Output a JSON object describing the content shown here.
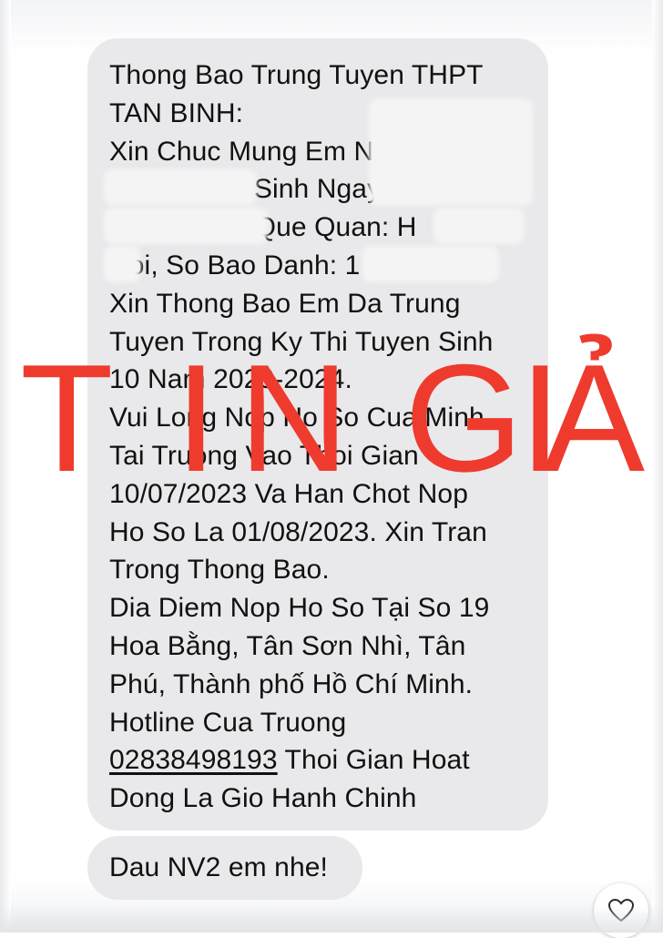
{
  "messages": [
    {
      "lines": [
        "Thong Bao Trung Tuyen THPT",
        "TAN BINH:",
        "Xin Chuc Mung Em Ng",
        ", Sinh Ngay",
        "2 /10/2008, Que Quan: H",
        "Noi, So Bao Danh: 1",
        "Xin Thong Bao Em Da Trung",
        "Tuyen Trong Ky Thi Tuyen Sinh",
        "10 Nam 2023-2024.",
        "Vui Long Nop Ho So Cua Minh",
        "Tai Truong Vao Thoi Gian",
        "10/07/2023 Va Han Chot Nop",
        "Ho So La 01/08/2023. Xin Tran",
        "Trong Thong Bao.",
        "Dia Diem Nop Ho So Tại So 19",
        "Hoa Bằng, Tân Sơn Nhì, Tân",
        "Phú, Thành phố Hồ Chí Minh.",
        "Hotline Cua Truong"
      ],
      "phone": "02838498193",
      "phone_tail": " Thoi Gian Hoat",
      "last_line": "Dong La Gio Hanh Chinh"
    },
    {
      "text": "Dau NV2 em nhe!"
    }
  ],
  "overlay": {
    "letters": [
      "T",
      "I",
      "N",
      "G",
      "I",
      "Ả"
    ],
    "text": "TIN GIẢ",
    "color": "#ee3b2e"
  },
  "reaction": {
    "icon": "heart-icon"
  },
  "colors": {
    "bubble": "#e9e9eb",
    "background": "#ffffff",
    "text": "#111111"
  }
}
